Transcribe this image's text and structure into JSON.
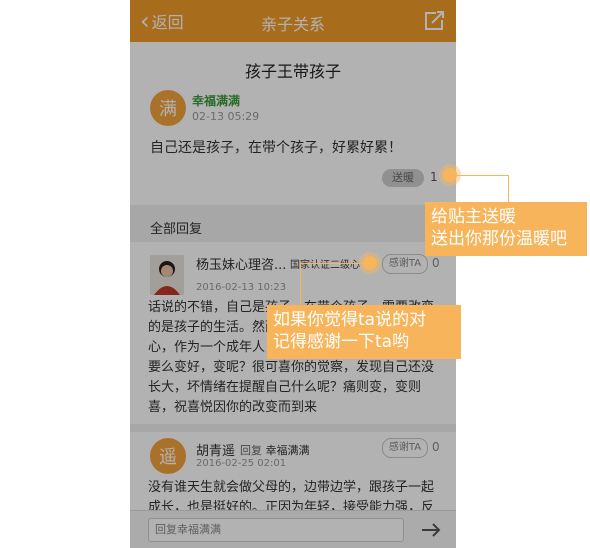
{
  "header": {
    "back_label": "返回",
    "title": "亲子关系"
  },
  "post": {
    "title": "孩子王带孩子",
    "author_avatar_char": "满",
    "author": "幸福满满",
    "time": "02-13 05:29",
    "body": "自己还是孩子，在带个孩子，好累好累！",
    "warm_button": "送暖",
    "warm_count": "1"
  },
  "section": {
    "title": "全部回复"
  },
  "replies": [
    {
      "name": "杨玉妹心理咨...",
      "cert": "国家认证二级心",
      "thank_label": "感谢TA",
      "count": "0",
      "time": "2016-02-13 10:23",
      "body": "话说的不错，自己是孩子，在带个孩子，需要改变的是孩子的生活。然而这一切，都需要你有责任心，作为一个成年人，需要发生改变，要么变坏，要么变好，变呢？很可喜你的觉察，发现自己还没长大，坏情绪在提醒自己什么呢？痛则变，变则喜，祝喜悦因你的改变而到来"
    },
    {
      "avatar_char": "遥",
      "name": "胡青遥",
      "reply_word": "回复",
      "reply_to": "幸福满满",
      "thank_label": "感谢TA",
      "count": "0",
      "time": "2016-02-25 02:01",
      "body": "没有谁天生就会做父母的，边带边学，跟孩子一起成长，也是挺好的。正因为年轻，接受能力强，反"
    }
  ],
  "input": {
    "placeholder": "回复幸福满满"
  },
  "tips": {
    "warm_tip_line1": "给贴主送暖",
    "warm_tip_line2": "送出你那份温暖吧",
    "thank_tip_line1": "如果你觉得ta说的对",
    "thank_tip_line2": "记得感谢一下ta哟"
  },
  "colors": {
    "brand": "#f19b2a",
    "tip": "#f7b45a",
    "username": "#3b9a3b"
  },
  "icons": {
    "back": "chevron-left-icon",
    "share": "share-icon",
    "send": "send-arrow-icon"
  }
}
